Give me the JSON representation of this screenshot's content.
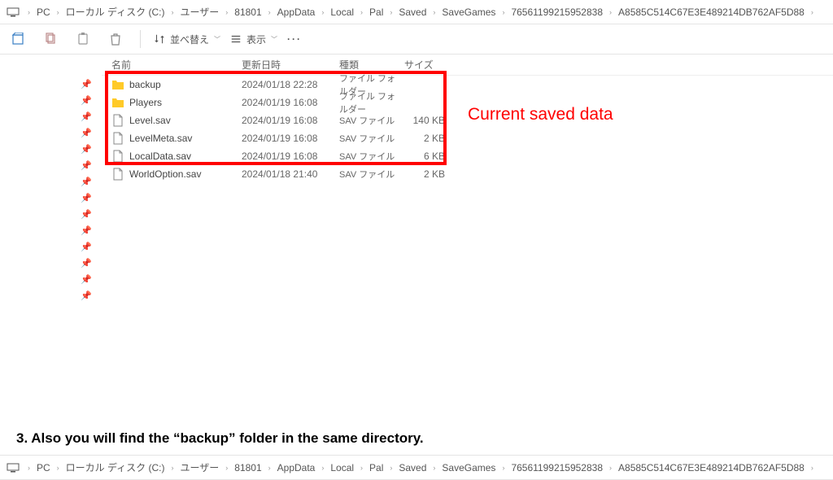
{
  "breadcrumb": [
    "PC",
    "ローカル ディスク (C:)",
    "ユーザー",
    "81801",
    "AppData",
    "Local",
    "Pal",
    "Saved",
    "SaveGames",
    "76561199215952838",
    "A8585C514C67E3E489214DB762AF5D88"
  ],
  "toolbar": {
    "sort": "並べ替え",
    "view": "表示"
  },
  "columns": {
    "name": "名前",
    "date": "更新日時",
    "type": "種類",
    "size": "サイズ"
  },
  "rows": [
    {
      "icon": "folder",
      "name": "backup",
      "date": "2024/01/18 22:28",
      "type": "ファイル フォルダー",
      "size": ""
    },
    {
      "icon": "folder",
      "name": "Players",
      "date": "2024/01/19 16:08",
      "type": "ファイル フォルダー",
      "size": ""
    },
    {
      "icon": "file",
      "name": "Level.sav",
      "date": "2024/01/19 16:08",
      "type": "SAV ファイル",
      "size": "140 KB"
    },
    {
      "icon": "file",
      "name": "LevelMeta.sav",
      "date": "2024/01/19 16:08",
      "type": "SAV ファイル",
      "size": "2 KB"
    },
    {
      "icon": "file",
      "name": "LocalData.sav",
      "date": "2024/01/19 16:08",
      "type": "SAV ファイル",
      "size": "6 KB"
    },
    {
      "icon": "file",
      "name": "WorldOption.sav",
      "date": "2024/01/18 21:40",
      "type": "SAV ファイル",
      "size": "2 KB"
    }
  ],
  "annotation": "Current saved data",
  "caption": "3.  Also you will find the “backup” folder in the same directory."
}
